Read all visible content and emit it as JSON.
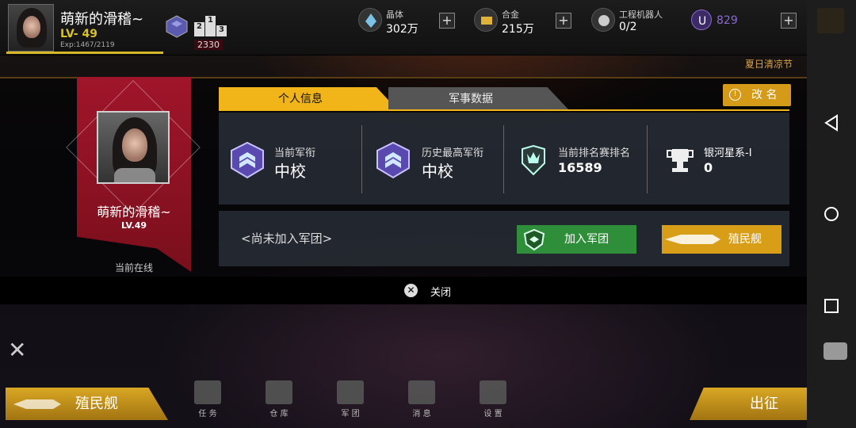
{
  "header": {
    "player_name": "萌新的滑稽~",
    "level": "LV- 49",
    "exp": "Exp:1467/2119",
    "score": "2330",
    "podium": [
      "2",
      "1",
      "3"
    ]
  },
  "resources": [
    {
      "label": "晶体",
      "value": "302万",
      "icon": "crystal-icon"
    },
    {
      "label": "合金",
      "value": "215万",
      "icon": "alloy-icon"
    },
    {
      "label": "工程机器人",
      "value": "0/2",
      "icon": "robot-icon"
    }
  ],
  "premium": {
    "value": "829",
    "icon": "u-coin-icon"
  },
  "event_label": "夏日清凉节",
  "profile": {
    "name": "萌新的滑稽~",
    "level": "LV.49",
    "status": "当前在线"
  },
  "tabs": [
    {
      "label": "个人信息",
      "active": true
    },
    {
      "label": "军事数据",
      "active": false
    }
  ],
  "rename_label": "改 名",
  "stats": [
    {
      "title": "当前军衔",
      "value": "中校",
      "icon": "rank-badge-icon"
    },
    {
      "title": "历史最高军衔",
      "value": "中校",
      "icon": "rank-badge-icon"
    },
    {
      "title": "当前排名赛排名",
      "value": "16589",
      "icon": "crown-shield-icon"
    },
    {
      "title": "银河星系-I",
      "value": "0",
      "icon": "trophy-icon"
    }
  ],
  "legion": {
    "none_text": "<尚未加入军团>",
    "join_label": "加入军团",
    "colony_label": "殖民舰"
  },
  "close_label": "关闭",
  "bottom_nav": [
    {
      "label": "任 务",
      "icon": "task-icon"
    },
    {
      "label": "仓 库",
      "icon": "warehouse-icon"
    },
    {
      "label": "军 团",
      "icon": "legion-icon"
    },
    {
      "label": "消 息",
      "icon": "mail-icon"
    },
    {
      "label": "设 置",
      "icon": "settings-icon"
    }
  ],
  "bottom_left_label": "殖民舰",
  "bottom_right_label": "出征",
  "colors": {
    "accent": "#f1b51a",
    "ribbon": "#8e1220",
    "join_green": "#2f8e3a"
  }
}
